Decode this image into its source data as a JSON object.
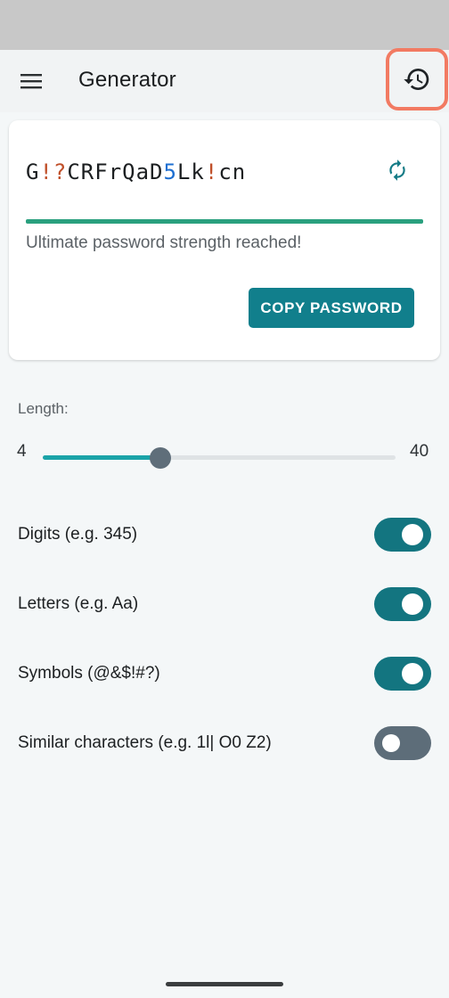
{
  "app_bar": {
    "title": "Generator",
    "menu_icon": "hamburger-menu-icon",
    "history_icon": "history-icon"
  },
  "card": {
    "password_segments": [
      {
        "text": "G",
        "kind": "letter"
      },
      {
        "text": "!?",
        "kind": "symbol"
      },
      {
        "text": "CRFrQaD",
        "kind": "letter"
      },
      {
        "text": "5",
        "kind": "digit"
      },
      {
        "text": "Lk",
        "kind": "letter"
      },
      {
        "text": "!",
        "kind": "symbol"
      },
      {
        "text": "cn",
        "kind": "letter"
      }
    ],
    "refresh_icon": "refresh-icon",
    "strength_text": "Ultimate password strength reached!",
    "strength_fraction": 1.0,
    "copy_label": "COPY PASSWORD"
  },
  "length": {
    "label": "Length:",
    "min_label": "4",
    "max_label": "40",
    "min": 4,
    "max": 40,
    "value": 16
  },
  "options": [
    {
      "label": "Digits (e.g. 345)",
      "enabled": true
    },
    {
      "label": "Letters (e.g. Aa)",
      "enabled": true
    },
    {
      "label": "Symbols (@&$!#?)",
      "enabled": true
    },
    {
      "label": "Similar characters (e.g. 1l| O0 Z2)",
      "enabled": false
    }
  ],
  "colors": {
    "accent": "#117f8c",
    "strength": "#2aa07e",
    "symbol_char": "#c0502a",
    "digit_char": "#1e6fd1",
    "highlight": "#f27a62"
  }
}
